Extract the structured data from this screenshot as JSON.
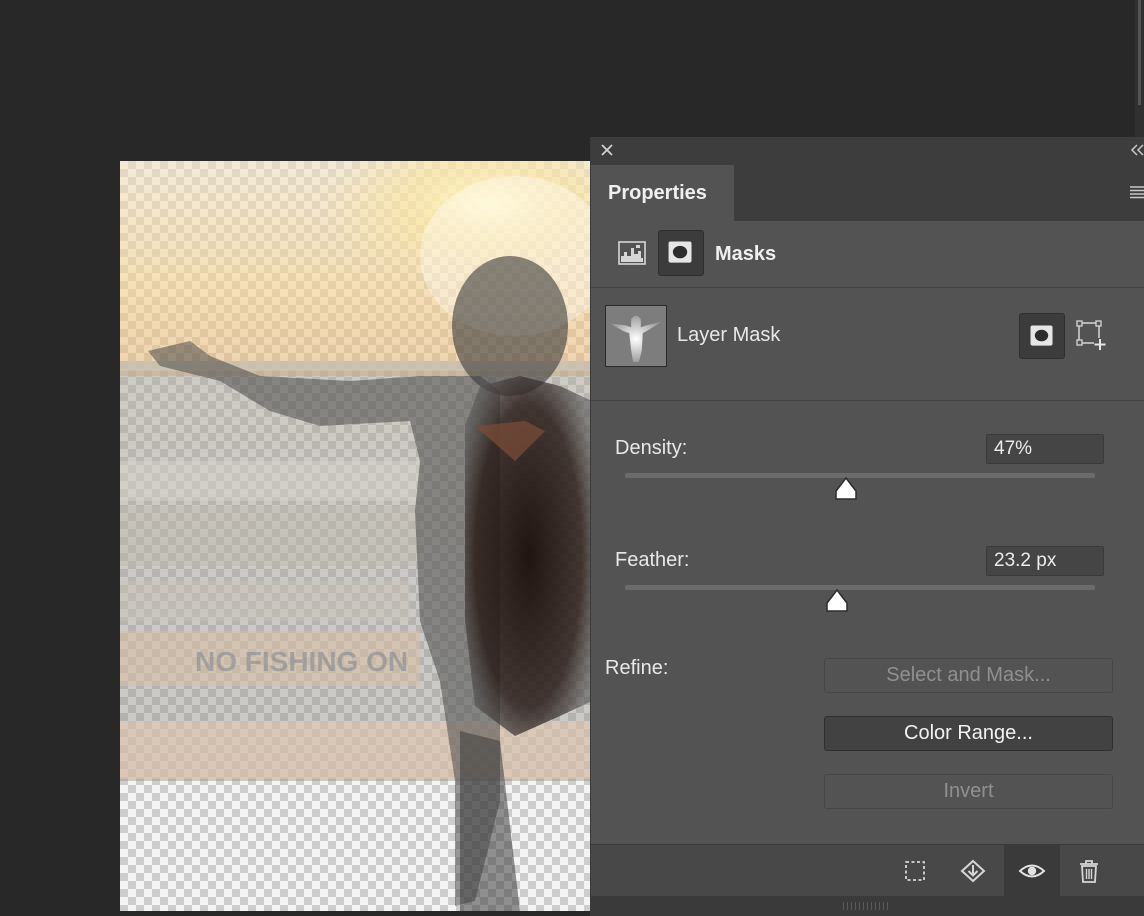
{
  "panel": {
    "tab_label": "Properties",
    "section_title": "Masks",
    "mask": {
      "label": "Layer Mask"
    },
    "density": {
      "label": "Density:",
      "value": "47%",
      "level": 0.47
    },
    "feather": {
      "label": "Feather:",
      "value": "23.2 px",
      "level": 0.45
    },
    "refine": {
      "label": "Refine:",
      "select_and_mask": "Select and Mask...",
      "color_range": "Color Range...",
      "invert": "Invert"
    },
    "icons": {
      "close": "close-icon",
      "collapse": "double-chevron-left-icon",
      "menu": "hamburger-menu-icon",
      "pixel_mask": "pixel-mask-icon",
      "vector_mask": "vector-mask-icon",
      "apply_mask": "apply-mask-icon",
      "vector_add": "vector-mask-add-icon",
      "load_selection": "dashed-selection-icon",
      "apply": "apply-mask-diamond-icon",
      "visibility": "eye-icon",
      "delete": "trash-icon"
    }
  },
  "colors": {
    "panel_bg": "#535353",
    "panel_dark": "#3d3d3d",
    "app_bg": "#282828",
    "text": "#e8e8e8",
    "disabled_text": "#909090"
  }
}
